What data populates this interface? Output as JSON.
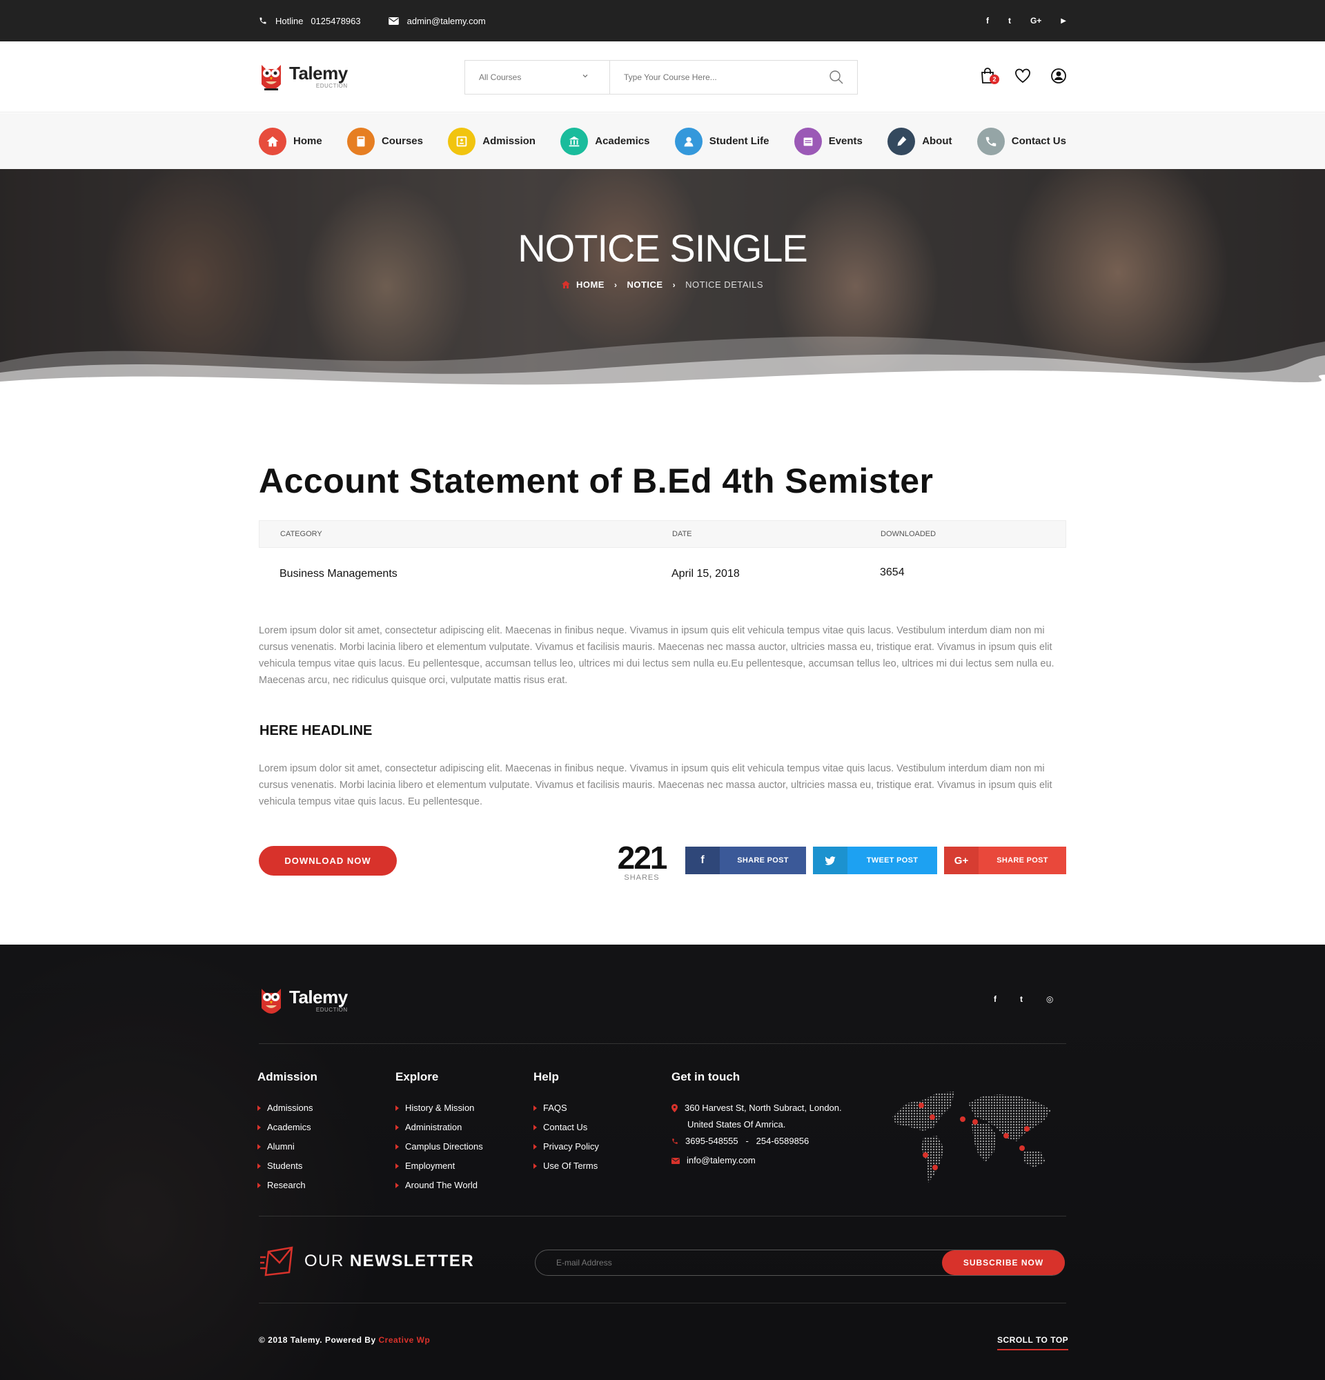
{
  "topbar": {
    "hotline_label": "Hotline",
    "hotline_number": "0125478963",
    "email": "admin@talemy.com",
    "social": [
      "f",
      "t",
      "G+",
      "▶"
    ]
  },
  "brand": {
    "name": "Talemy",
    "tagline": "EDUCTION"
  },
  "search": {
    "category": "All Courses",
    "placeholder": "Type Your Course Here..."
  },
  "header_icons": {
    "cart_count": "2"
  },
  "nav": [
    {
      "label": "Home",
      "icon": "home-icon",
      "color": "#e74c3c"
    },
    {
      "label": "Courses",
      "icon": "book-icon",
      "color": "#e67e22"
    },
    {
      "label": "Admission",
      "icon": "id-card-icon",
      "color": "#f1c40f"
    },
    {
      "label": "Academics",
      "icon": "building-icon",
      "color": "#1abc9c"
    },
    {
      "label": "Student Life",
      "icon": "user-icon",
      "color": "#3498db"
    },
    {
      "label": "Events",
      "icon": "calendar-icon",
      "color": "#9b59b6"
    },
    {
      "label": "About",
      "icon": "pen-icon",
      "color": "#34495e"
    },
    {
      "label": "Contact Us",
      "icon": "phone-icon",
      "color": "#95a5a6"
    }
  ],
  "hero": {
    "title": "NOTICE SINGLE",
    "breadcrumb": [
      "HOME",
      "NOTICE",
      "NOTICE DETAILS"
    ]
  },
  "notice": {
    "title": "Account Statement of B.Ed 4th Semister",
    "headers": {
      "category": "CATEGORY",
      "date": "DATE",
      "downloaded": "DOWNLOADED"
    },
    "category": "Business Managements",
    "date": "April 15, 2018",
    "downloaded": "3654",
    "para1": "Lorem ipsum dolor sit amet, consectetur adipiscing elit. Maecenas in finibus neque. Vivamus in ipsum quis elit vehicula tempus vitae quis lacus. Vestibulum interdum diam non mi cursus venenatis. Morbi lacinia libero et elementum vulputate. Vivamus et facilisis mauris. Maecenas nec massa auctor, ultricies massa eu, tristique erat. Vivamus in ipsum quis elit vehicula tempus vitae quis lacus. Eu pellentesque, accumsan tellus leo, ultrices mi dui lectus sem nulla eu.Eu pellentesque, accumsan tellus leo, ultrices mi dui lectus sem nulla eu. Maecenas arcu, nec ridiculus quisque orci, vulputate mattis risus erat.",
    "headline": "HERE HEADLINE",
    "para2": "Lorem ipsum dolor sit amet, consectetur adipiscing elit. Maecenas in finibus neque. Vivamus in ipsum quis elit vehicula tempus vitae quis lacus. Vestibulum interdum diam non mi cursus venenatis. Morbi lacinia libero et elementum vulputate. Vivamus et facilisis mauris. Maecenas nec massa auctor, ultricies massa eu, tristique erat. Vivamus in ipsum quis elit vehicula tempus vitae quis lacus. Eu pellentesque.",
    "download_label": "DOWNLOAD NOW",
    "shares_count": "221",
    "shares_label": "SHARES",
    "share_buttons": [
      {
        "label": "SHARE POST",
        "network": "facebook",
        "icon_color": "#2f4779",
        "text_color": "#3b5998"
      },
      {
        "label": "TWEET POST",
        "network": "twitter",
        "icon_color": "#1c92cf",
        "text_color": "#1da1f2"
      },
      {
        "label": "SHARE POST",
        "network": "google-plus",
        "icon_color": "#d73d32",
        "text_color": "#e9483b"
      }
    ]
  },
  "footer": {
    "social": [
      "f",
      "t",
      "◎"
    ],
    "columns": [
      {
        "title": "Admission",
        "items": [
          "Admissions",
          "Academics",
          "Alumni",
          "Students",
          "Research"
        ]
      },
      {
        "title": "Explore",
        "items": [
          "History & Mission",
          "Administration",
          "Camplus Directions",
          "Employment",
          "Around The World"
        ]
      },
      {
        "title": "Help",
        "items": [
          "FAQS",
          "Contact Us",
          "Privacy Policy",
          "Use Of Terms"
        ]
      }
    ],
    "contact": {
      "title": "Get in touch",
      "address1": "360 Harvest St, North Subract, London.",
      "address2": "United States Of Amrica.",
      "phone": "3695-548555   -   254-6589856",
      "email": "info@talemy.com"
    },
    "newsletter": {
      "title_light": "OUR",
      "title_bold": "NEWSLETTER",
      "placeholder": "E-mail Address",
      "button": "SUBSCRIBE NOW"
    },
    "copyright": "© 2018 Talemy.  Powered By",
    "powered_by": "Creative Wp",
    "scroll_top": "SCROLL TO TOP"
  },
  "colors": {
    "accent": "#d8322b",
    "dark": "#222222"
  }
}
